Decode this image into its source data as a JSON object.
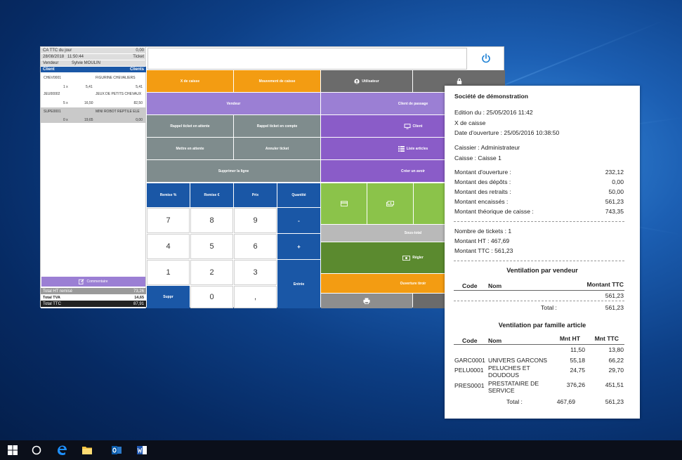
{
  "ticket": {
    "ca_label": "CA TTC du jour",
    "ca_value": "0,00",
    "date": "28/08/2018",
    "time": "11:50:44",
    "ticket_label": "Ticket",
    "vendor_label": "Vendeur",
    "vendor_name": "Sylvie MOULIN",
    "client_label": "Client",
    "clients_link": "Clients",
    "lines": [
      {
        "code": "CHEV0001",
        "name": "FIGURINE CHEVALIERS",
        "qty": "1 x",
        "unit": "5,41",
        "total": "5,41"
      },
      {
        "code": "JEU00002",
        "name": "JEUX DE PETITS CHEVAUX",
        "qty": "5 x",
        "unit": "16,50",
        "total": "82,50"
      },
      {
        "code": "SUPE0001",
        "name": "MINI ROBOT REPTILE ELE",
        "qty": "0 x",
        "unit": "19,65",
        "total": "0,00"
      }
    ],
    "comment_label": "Commentaire",
    "total_ht_label": "Total HT remisé",
    "total_ht": "73,26",
    "total_tva_label": "Total TVA",
    "total_tva": "14,65",
    "total_ttc_label": "Total TTC",
    "total_ttc": "87,91"
  },
  "buttons": {
    "x_caisse": "X de caisse",
    "mouvement": "Mouvement de caisse",
    "utilisateur": "Utilisateur",
    "vendeur": "Vendeur",
    "client_passage": "Client de passage",
    "rappel_attente": "Rappel ticket en attente",
    "rappel_compte": "Rappel ticket en compte",
    "client": "Client",
    "mettre_attente": "Mettre en attente",
    "annuler": "Annuler ticket",
    "liste_articles": "Liste articles",
    "supprimer_ligne": "Supprimer la ligne",
    "creer_avoir": "Créer un avoir",
    "remise_pct": "Remise %",
    "remise_eur": "Remise €",
    "prix": "Prix",
    "quantite": "Quantité",
    "minus": "-",
    "plus": "+",
    "entree": "Entrée",
    "suppr": "Suppr",
    "sous_total": "Sous-total",
    "regler": "Régler",
    "ouverture_tiroir": "Ouverture tiroir"
  },
  "keypad": [
    "7",
    "8",
    "9",
    "4",
    "5",
    "6",
    "1",
    "2",
    "3",
    "0",
    ","
  ],
  "receipt": {
    "company": "Société de démonstration",
    "edition": "Edition du : 25/05/2016 11:42",
    "x_caisse": "X de caisse",
    "date_ouverture": "Date d'ouverture : 25/05/2016 10:38:50",
    "caissier": "Caissier : Administrateur",
    "caisse": "Caisse : Caisse 1",
    "amounts": [
      {
        "label": "Montant d'ouverture :",
        "value": "232,12"
      },
      {
        "label": "Montant des dépôts :",
        "value": "0,00"
      },
      {
        "label": "Montant des retraits :",
        "value": "50,00"
      },
      {
        "label": "Montant encaissés :",
        "value": "561,23"
      },
      {
        "label": "Montant théorique de caisse :",
        "value": "743,35"
      }
    ],
    "nb_tickets": "Nombre de tickets : 1",
    "montant_ht": "Montant HT : 467,69",
    "montant_ttc": "Montant TTC : 561,23",
    "vendeur_title": "Ventilation par vendeur",
    "col_code": "Code",
    "col_nom": "Nom",
    "col_montant_ttc": "Montant TTC",
    "vendeur_row_value": "561,23",
    "vendeur_total_label": "Total :",
    "vendeur_total": "561,23",
    "famille_title": "Ventilation par famille article",
    "col_mnt_ht": "Mnt HT",
    "col_mnt_ttc": "Mnt TTC",
    "famille_rows": [
      {
        "code": "",
        "nom": "",
        "ht": "11,50",
        "ttc": "13,80"
      },
      {
        "code": "GARC0001",
        "nom": "UNIVERS GARCONS",
        "ht": "55,18",
        "ttc": "66,22"
      },
      {
        "code": "PELU0001",
        "nom": "PELUCHES ET DOUDOUS",
        "ht": "24,75",
        "ttc": "29,70"
      },
      {
        "code": "PRES0001",
        "nom": "PRESTATAIRE DE SERVICE",
        "ht": "376,26",
        "ttc": "451,51"
      }
    ],
    "famille_total_label": "Total :",
    "famille_total_ht": "467,69",
    "famille_total_ttc": "561,23"
  }
}
